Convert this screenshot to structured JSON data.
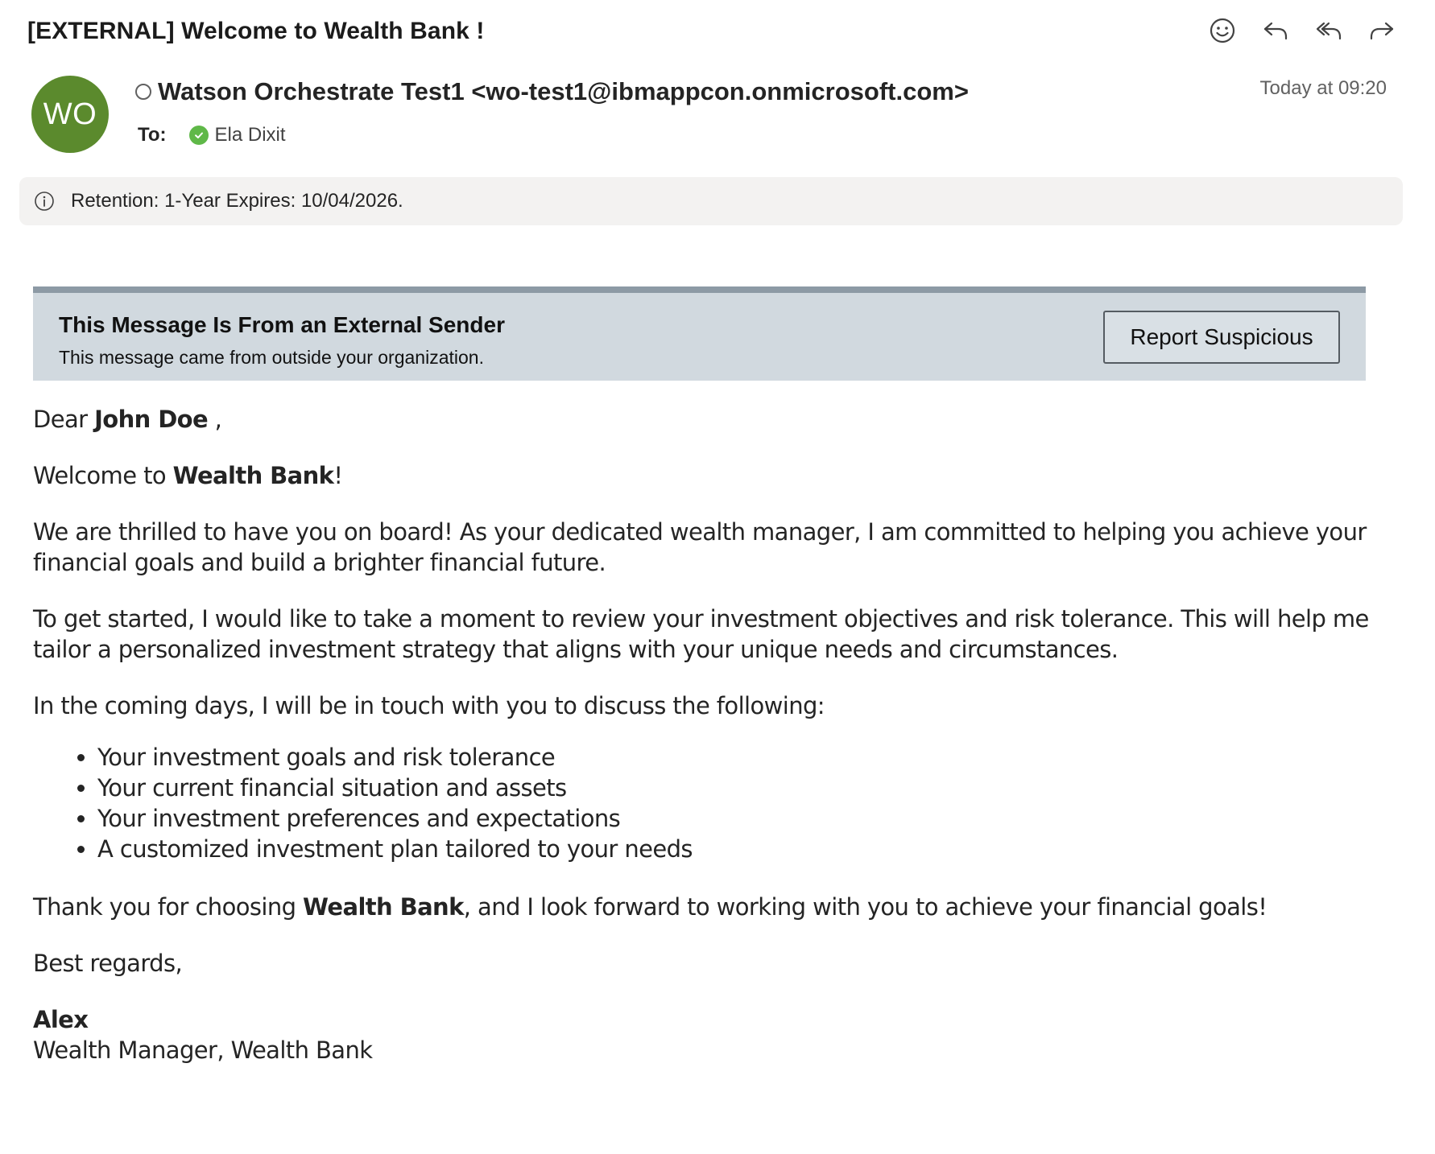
{
  "email": {
    "subject": "[EXTERNAL] Welcome to Wealth Bank !",
    "avatar_initials": "WO",
    "avatar_color": "#5b8a2d",
    "sender": "Watson Orchestrate Test1 <wo-test1@ibmappcon.onmicrosoft.com>",
    "timestamp": "Today at 09:20",
    "to_label": "To:",
    "recipient": "Ela Dixit",
    "toolbar": [
      {
        "icon": "emoji-reaction-icon"
      },
      {
        "icon": "reply-icon"
      },
      {
        "icon": "reply-all-icon"
      },
      {
        "icon": "forward-icon"
      }
    ]
  },
  "retention": {
    "text": "Retention: 1-Year Expires: 10/04/2026."
  },
  "banner": {
    "title": "This Message Is From an External Sender",
    "subtitle": "This message came from outside your organization.",
    "button_label": "Report Suspicious"
  },
  "body": {
    "greeting_prefix": "Dear ",
    "greeting_name": "John Doe",
    "greeting_suffix": " ,",
    "welcome_prefix": "Welcome to ",
    "welcome_bank": "Wealth Bank",
    "welcome_suffix": "!",
    "para1": "We are thrilled to have you on board! As your dedicated wealth manager, I am committed to helping you achieve your financial goals and build a brighter financial future.",
    "para2": "To get started, I would like to take a moment to review your investment objectives and risk tolerance. This will help me tailor a personalized investment strategy that aligns with your unique needs and circumstances.",
    "para3": "In the coming days, I will be in touch with you to discuss the following:",
    "bullets": [
      "Your investment goals and risk tolerance",
      "Your current financial situation and assets",
      "Your investment preferences and expectations",
      "A customized investment plan tailored to your needs"
    ],
    "thanks_prefix": "Thank you for choosing ",
    "thanks_bank": "Wealth Bank",
    "thanks_suffix": ", and I look forward to working with you to achieve your financial goals!",
    "closing": "Best regards,",
    "signature_name": "Alex",
    "signature_title": "Wealth Manager, Wealth Bank"
  }
}
